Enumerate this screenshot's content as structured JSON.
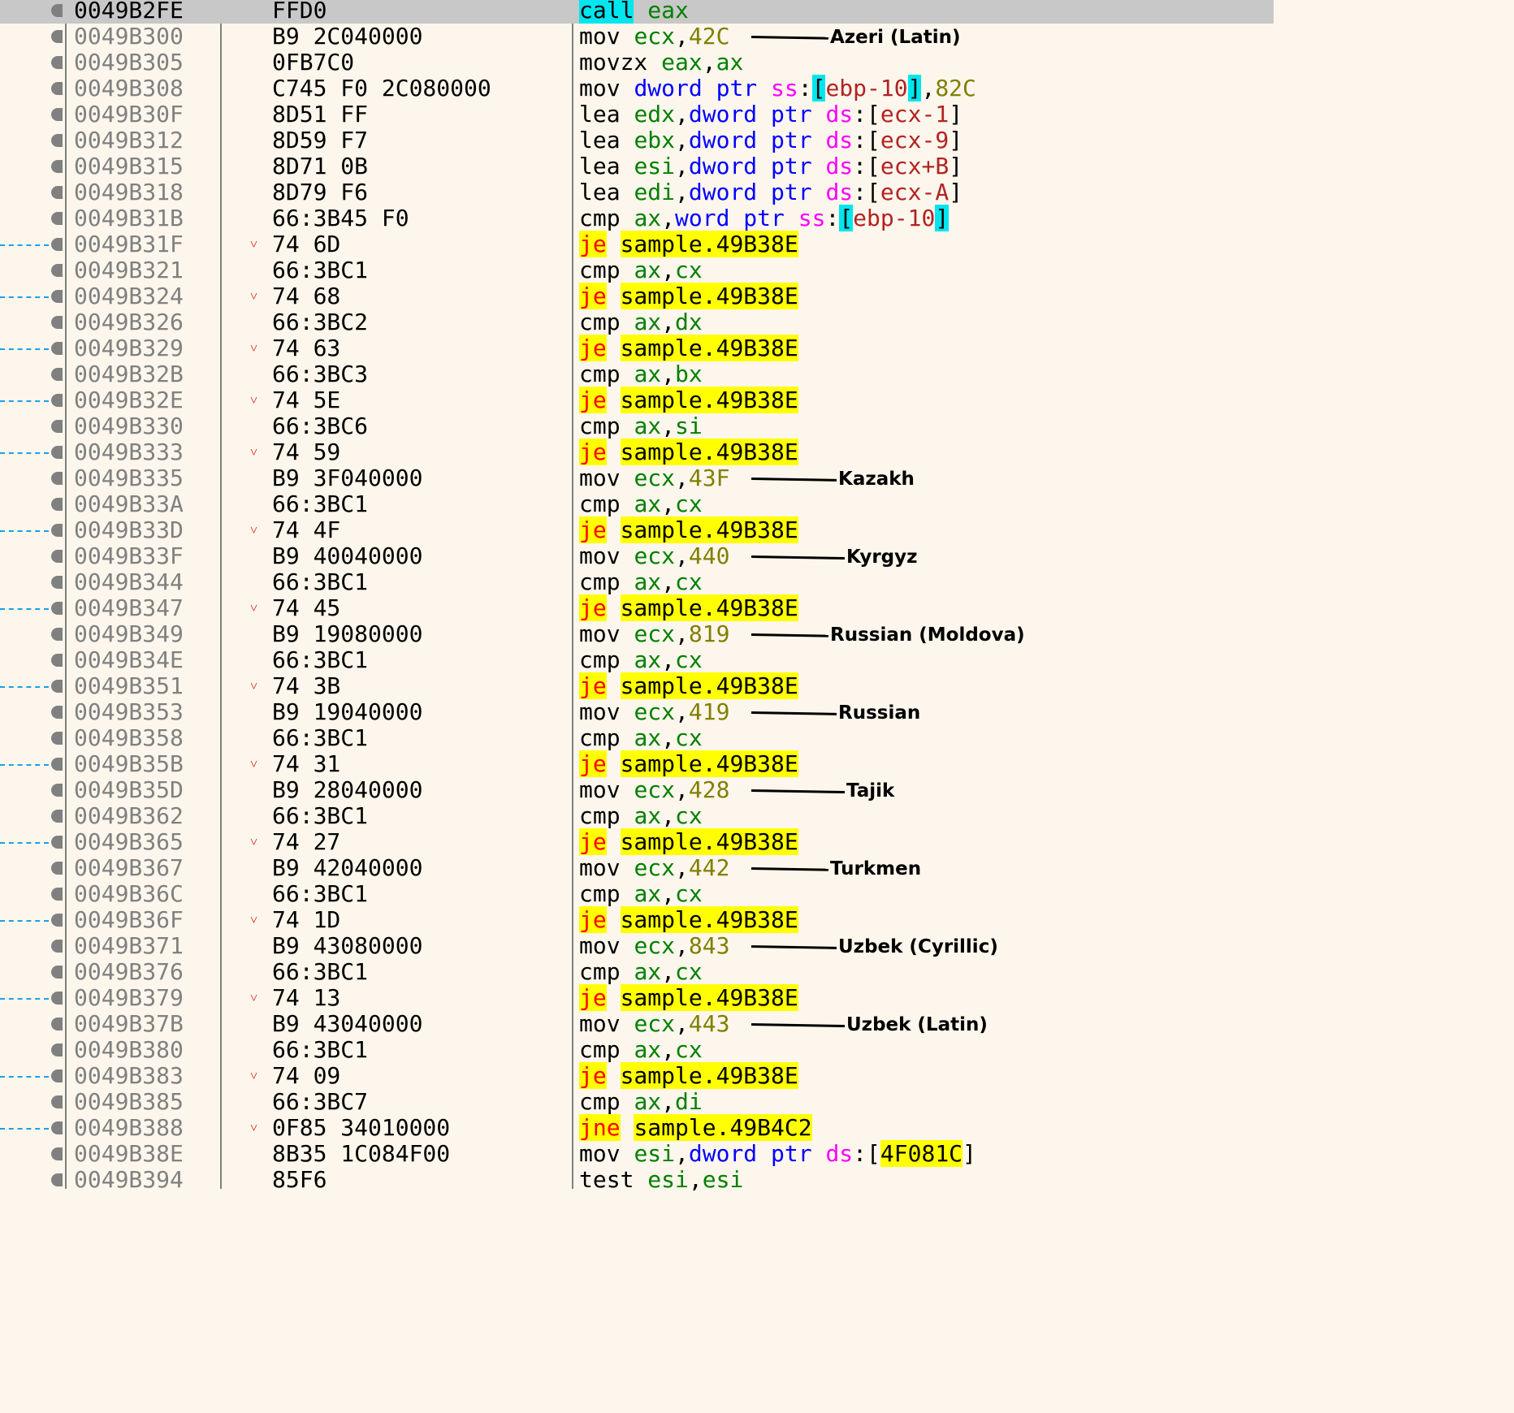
{
  "rows": [
    {
      "addr": "0049B2FE",
      "bytes": "FFD0",
      "jump": false,
      "selected": true,
      "ins": [
        [
          "callhl",
          "call"
        ],
        [
          "sp",
          " "
        ],
        [
          "reg",
          "eax"
        ]
      ]
    },
    {
      "addr": "0049B300",
      "bytes": "B9 2C040000",
      "jump": false,
      "ins": [
        [
          "mn",
          "mov"
        ],
        [
          "sp",
          " "
        ],
        [
          "reg",
          "ecx"
        ],
        [
          "p",
          ","
        ],
        [
          "num",
          "42C"
        ]
      ]
    },
    {
      "addr": "0049B305",
      "bytes": "0FB7C0",
      "jump": false,
      "ins": [
        [
          "mn",
          "movzx"
        ],
        [
          "sp",
          " "
        ],
        [
          "reg",
          "eax"
        ],
        [
          "p",
          ","
        ],
        [
          "reg",
          "ax"
        ]
      ]
    },
    {
      "addr": "0049B308",
      "bytes": "C745 F0 2C080000",
      "jump": false,
      "ins": [
        [
          "mn",
          "mov"
        ],
        [
          "sp",
          " "
        ],
        [
          "kw",
          "dword ptr"
        ],
        [
          "sp",
          " "
        ],
        [
          "seg",
          "ss"
        ],
        [
          "p",
          ":"
        ],
        [
          "brhl",
          "["
        ],
        [
          "mem",
          "ebp-10"
        ],
        [
          "brhl",
          "]"
        ],
        [
          "p",
          ","
        ],
        [
          "num",
          "82C"
        ]
      ]
    },
    {
      "addr": "0049B30F",
      "bytes": "8D51 FF",
      "jump": false,
      "ins": [
        [
          "mn",
          "lea"
        ],
        [
          "sp",
          " "
        ],
        [
          "reg",
          "edx"
        ],
        [
          "p",
          ","
        ],
        [
          "kw",
          "dword ptr"
        ],
        [
          "sp",
          " "
        ],
        [
          "seg",
          "ds"
        ],
        [
          "p",
          ":"
        ],
        [
          "br",
          "["
        ],
        [
          "mem",
          "ecx-1"
        ],
        [
          "br",
          "]"
        ]
      ]
    },
    {
      "addr": "0049B312",
      "bytes": "8D59 F7",
      "jump": false,
      "ins": [
        [
          "mn",
          "lea"
        ],
        [
          "sp",
          " "
        ],
        [
          "reg",
          "ebx"
        ],
        [
          "p",
          ","
        ],
        [
          "kw",
          "dword ptr"
        ],
        [
          "sp",
          " "
        ],
        [
          "seg",
          "ds"
        ],
        [
          "p",
          ":"
        ],
        [
          "br",
          "["
        ],
        [
          "mem",
          "ecx-9"
        ],
        [
          "br",
          "]"
        ]
      ]
    },
    {
      "addr": "0049B315",
      "bytes": "8D71 0B",
      "jump": false,
      "ins": [
        [
          "mn",
          "lea"
        ],
        [
          "sp",
          " "
        ],
        [
          "reg",
          "esi"
        ],
        [
          "p",
          ","
        ],
        [
          "kw",
          "dword ptr"
        ],
        [
          "sp",
          " "
        ],
        [
          "seg",
          "ds"
        ],
        [
          "p",
          ":"
        ],
        [
          "br",
          "["
        ],
        [
          "mem",
          "ecx+B"
        ],
        [
          "br",
          "]"
        ]
      ]
    },
    {
      "addr": "0049B318",
      "bytes": "8D79 F6",
      "jump": false,
      "ins": [
        [
          "mn",
          "lea"
        ],
        [
          "sp",
          " "
        ],
        [
          "reg",
          "edi"
        ],
        [
          "p",
          ","
        ],
        [
          "kw",
          "dword ptr"
        ],
        [
          "sp",
          " "
        ],
        [
          "seg",
          "ds"
        ],
        [
          "p",
          ":"
        ],
        [
          "br",
          "["
        ],
        [
          "mem",
          "ecx-A"
        ],
        [
          "br",
          "]"
        ]
      ]
    },
    {
      "addr": "0049B31B",
      "bytes": "66:3B45 F0",
      "jump": false,
      "ins": [
        [
          "mn",
          "cmp"
        ],
        [
          "sp",
          " "
        ],
        [
          "reg",
          "ax"
        ],
        [
          "p",
          ","
        ],
        [
          "kw",
          "word ptr"
        ],
        [
          "sp",
          " "
        ],
        [
          "seg",
          "ss"
        ],
        [
          "p",
          ":"
        ],
        [
          "brhl",
          "["
        ],
        [
          "mem",
          "ebp-10"
        ],
        [
          "brhl",
          "]"
        ]
      ]
    },
    {
      "addr": "0049B31F",
      "bytes": "74 6D",
      "jump": true,
      "ins": [
        [
          "jcc",
          "je"
        ],
        [
          "sp",
          " "
        ],
        [
          "tgt",
          "sample.49B38E"
        ]
      ]
    },
    {
      "addr": "0049B321",
      "bytes": "66:3BC1",
      "jump": false,
      "ins": [
        [
          "mn",
          "cmp"
        ],
        [
          "sp",
          " "
        ],
        [
          "reg",
          "ax"
        ],
        [
          "p",
          ","
        ],
        [
          "reg",
          "cx"
        ]
      ]
    },
    {
      "addr": "0049B324",
      "bytes": "74 68",
      "jump": true,
      "ins": [
        [
          "jcc",
          "je"
        ],
        [
          "sp",
          " "
        ],
        [
          "tgt",
          "sample.49B38E"
        ]
      ]
    },
    {
      "addr": "0049B326",
      "bytes": "66:3BC2",
      "jump": false,
      "ins": [
        [
          "mn",
          "cmp"
        ],
        [
          "sp",
          " "
        ],
        [
          "reg",
          "ax"
        ],
        [
          "p",
          ","
        ],
        [
          "reg",
          "dx"
        ]
      ]
    },
    {
      "addr": "0049B329",
      "bytes": "74 63",
      "jump": true,
      "ins": [
        [
          "jcc",
          "je"
        ],
        [
          "sp",
          " "
        ],
        [
          "tgt",
          "sample.49B38E"
        ]
      ]
    },
    {
      "addr": "0049B32B",
      "bytes": "66:3BC3",
      "jump": false,
      "ins": [
        [
          "mn",
          "cmp"
        ],
        [
          "sp",
          " "
        ],
        [
          "reg",
          "ax"
        ],
        [
          "p",
          ","
        ],
        [
          "reg",
          "bx"
        ]
      ]
    },
    {
      "addr": "0049B32E",
      "bytes": "74 5E",
      "jump": true,
      "ins": [
        [
          "jcc",
          "je"
        ],
        [
          "sp",
          " "
        ],
        [
          "tgt",
          "sample.49B38E"
        ]
      ]
    },
    {
      "addr": "0049B330",
      "bytes": "66:3BC6",
      "jump": false,
      "ins": [
        [
          "mn",
          "cmp"
        ],
        [
          "sp",
          " "
        ],
        [
          "reg",
          "ax"
        ],
        [
          "p",
          ","
        ],
        [
          "reg",
          "si"
        ]
      ]
    },
    {
      "addr": "0049B333",
      "bytes": "74 59",
      "jump": true,
      "ins": [
        [
          "jcc",
          "je"
        ],
        [
          "sp",
          " "
        ],
        [
          "tgt",
          "sample.49B38E"
        ]
      ]
    },
    {
      "addr": "0049B335",
      "bytes": "B9 3F040000",
      "jump": false,
      "ins": [
        [
          "mn",
          "mov"
        ],
        [
          "sp",
          " "
        ],
        [
          "reg",
          "ecx"
        ],
        [
          "p",
          ","
        ],
        [
          "num",
          "43F"
        ]
      ]
    },
    {
      "addr": "0049B33A",
      "bytes": "66:3BC1",
      "jump": false,
      "ins": [
        [
          "mn",
          "cmp"
        ],
        [
          "sp",
          " "
        ],
        [
          "reg",
          "ax"
        ],
        [
          "p",
          ","
        ],
        [
          "reg",
          "cx"
        ]
      ]
    },
    {
      "addr": "0049B33D",
      "bytes": "74 4F",
      "jump": true,
      "ins": [
        [
          "jcc",
          "je"
        ],
        [
          "sp",
          " "
        ],
        [
          "tgt",
          "sample.49B38E"
        ]
      ]
    },
    {
      "addr": "0049B33F",
      "bytes": "B9 40040000",
      "jump": false,
      "ins": [
        [
          "mn",
          "mov"
        ],
        [
          "sp",
          " "
        ],
        [
          "reg",
          "ecx"
        ],
        [
          "p",
          ","
        ],
        [
          "num",
          "440"
        ]
      ]
    },
    {
      "addr": "0049B344",
      "bytes": "66:3BC1",
      "jump": false,
      "ins": [
        [
          "mn",
          "cmp"
        ],
        [
          "sp",
          " "
        ],
        [
          "reg",
          "ax"
        ],
        [
          "p",
          ","
        ],
        [
          "reg",
          "cx"
        ]
      ]
    },
    {
      "addr": "0049B347",
      "bytes": "74 45",
      "jump": true,
      "ins": [
        [
          "jcc",
          "je"
        ],
        [
          "sp",
          " "
        ],
        [
          "tgt",
          "sample.49B38E"
        ]
      ]
    },
    {
      "addr": "0049B349",
      "bytes": "B9 19080000",
      "jump": false,
      "ins": [
        [
          "mn",
          "mov"
        ],
        [
          "sp",
          " "
        ],
        [
          "reg",
          "ecx"
        ],
        [
          "p",
          ","
        ],
        [
          "num",
          "819"
        ]
      ]
    },
    {
      "addr": "0049B34E",
      "bytes": "66:3BC1",
      "jump": false,
      "ins": [
        [
          "mn",
          "cmp"
        ],
        [
          "sp",
          " "
        ],
        [
          "reg",
          "ax"
        ],
        [
          "p",
          ","
        ],
        [
          "reg",
          "cx"
        ]
      ]
    },
    {
      "addr": "0049B351",
      "bytes": "74 3B",
      "jump": true,
      "ins": [
        [
          "jcc",
          "je"
        ],
        [
          "sp",
          " "
        ],
        [
          "tgt",
          "sample.49B38E"
        ]
      ]
    },
    {
      "addr": "0049B353",
      "bytes": "B9 19040000",
      "jump": false,
      "ins": [
        [
          "mn",
          "mov"
        ],
        [
          "sp",
          " "
        ],
        [
          "reg",
          "ecx"
        ],
        [
          "p",
          ","
        ],
        [
          "num",
          "419"
        ]
      ]
    },
    {
      "addr": "0049B358",
      "bytes": "66:3BC1",
      "jump": false,
      "ins": [
        [
          "mn",
          "cmp"
        ],
        [
          "sp",
          " "
        ],
        [
          "reg",
          "ax"
        ],
        [
          "p",
          ","
        ],
        [
          "reg",
          "cx"
        ]
      ]
    },
    {
      "addr": "0049B35B",
      "bytes": "74 31",
      "jump": true,
      "ins": [
        [
          "jcc",
          "je"
        ],
        [
          "sp",
          " "
        ],
        [
          "tgt",
          "sample.49B38E"
        ]
      ]
    },
    {
      "addr": "0049B35D",
      "bytes": "B9 28040000",
      "jump": false,
      "ins": [
        [
          "mn",
          "mov"
        ],
        [
          "sp",
          " "
        ],
        [
          "reg",
          "ecx"
        ],
        [
          "p",
          ","
        ],
        [
          "num",
          "428"
        ]
      ]
    },
    {
      "addr": "0049B362",
      "bytes": "66:3BC1",
      "jump": false,
      "ins": [
        [
          "mn",
          "cmp"
        ],
        [
          "sp",
          " "
        ],
        [
          "reg",
          "ax"
        ],
        [
          "p",
          ","
        ],
        [
          "reg",
          "cx"
        ]
      ]
    },
    {
      "addr": "0049B365",
      "bytes": "74 27",
      "jump": true,
      "ins": [
        [
          "jcc",
          "je"
        ],
        [
          "sp",
          " "
        ],
        [
          "tgt",
          "sample.49B38E"
        ]
      ]
    },
    {
      "addr": "0049B367",
      "bytes": "B9 42040000",
      "jump": false,
      "ins": [
        [
          "mn",
          "mov"
        ],
        [
          "sp",
          " "
        ],
        [
          "reg",
          "ecx"
        ],
        [
          "p",
          ","
        ],
        [
          "num",
          "442"
        ]
      ]
    },
    {
      "addr": "0049B36C",
      "bytes": "66:3BC1",
      "jump": false,
      "ins": [
        [
          "mn",
          "cmp"
        ],
        [
          "sp",
          " "
        ],
        [
          "reg",
          "ax"
        ],
        [
          "p",
          ","
        ],
        [
          "reg",
          "cx"
        ]
      ]
    },
    {
      "addr": "0049B36F",
      "bytes": "74 1D",
      "jump": true,
      "ins": [
        [
          "jcc",
          "je"
        ],
        [
          "sp",
          " "
        ],
        [
          "tgt",
          "sample.49B38E"
        ]
      ]
    },
    {
      "addr": "0049B371",
      "bytes": "B9 43080000",
      "jump": false,
      "ins": [
        [
          "mn",
          "mov"
        ],
        [
          "sp",
          " "
        ],
        [
          "reg",
          "ecx"
        ],
        [
          "p",
          ","
        ],
        [
          "num",
          "843"
        ]
      ]
    },
    {
      "addr": "0049B376",
      "bytes": "66:3BC1",
      "jump": false,
      "ins": [
        [
          "mn",
          "cmp"
        ],
        [
          "sp",
          " "
        ],
        [
          "reg",
          "ax"
        ],
        [
          "p",
          ","
        ],
        [
          "reg",
          "cx"
        ]
      ]
    },
    {
      "addr": "0049B379",
      "bytes": "74 13",
      "jump": true,
      "ins": [
        [
          "jcc",
          "je"
        ],
        [
          "sp",
          " "
        ],
        [
          "tgt",
          "sample.49B38E"
        ]
      ]
    },
    {
      "addr": "0049B37B",
      "bytes": "B9 43040000",
      "jump": false,
      "ins": [
        [
          "mn",
          "mov"
        ],
        [
          "sp",
          " "
        ],
        [
          "reg",
          "ecx"
        ],
        [
          "p",
          ","
        ],
        [
          "num",
          "443"
        ]
      ]
    },
    {
      "addr": "0049B380",
      "bytes": "66:3BC1",
      "jump": false,
      "ins": [
        [
          "mn",
          "cmp"
        ],
        [
          "sp",
          " "
        ],
        [
          "reg",
          "ax"
        ],
        [
          "p",
          ","
        ],
        [
          "reg",
          "cx"
        ]
      ]
    },
    {
      "addr": "0049B383",
      "bytes": "74 09",
      "jump": true,
      "ins": [
        [
          "jcc",
          "je"
        ],
        [
          "sp",
          " "
        ],
        [
          "tgt",
          "sample.49B38E"
        ]
      ]
    },
    {
      "addr": "0049B385",
      "bytes": "66:3BC7",
      "jump": false,
      "ins": [
        [
          "mn",
          "cmp"
        ],
        [
          "sp",
          " "
        ],
        [
          "reg",
          "ax"
        ],
        [
          "p",
          ","
        ],
        [
          "reg",
          "di"
        ]
      ]
    },
    {
      "addr": "0049B388",
      "bytes": "0F85 34010000",
      "jump": true,
      "ins": [
        [
          "jcc",
          "jne"
        ],
        [
          "sp",
          " "
        ],
        [
          "tgt",
          "sample.49B4C2"
        ]
      ]
    },
    {
      "addr": "0049B38E",
      "bytes": "8B35 1C084F00",
      "jump": false,
      "ins": [
        [
          "mn",
          "mov"
        ],
        [
          "sp",
          " "
        ],
        [
          "reg",
          "esi"
        ],
        [
          "p",
          ","
        ],
        [
          "kw",
          "dword ptr"
        ],
        [
          "sp",
          " "
        ],
        [
          "seg",
          "ds"
        ],
        [
          "p",
          ":"
        ],
        [
          "br",
          "["
        ],
        [
          "hlnum",
          "4F081C"
        ],
        [
          "br",
          "]"
        ]
      ]
    },
    {
      "addr": "0049B394",
      "bytes": "85F6",
      "jump": false,
      "ins": [
        [
          "mn",
          "test"
        ],
        [
          "sp",
          " "
        ],
        [
          "reg",
          "esi"
        ],
        [
          "p",
          ","
        ],
        [
          "reg",
          "esi"
        ]
      ]
    }
  ],
  "annotations": [
    {
      "row": 1,
      "label": "Azeri (Latin)"
    },
    {
      "row": 18,
      "label": "Kazakh"
    },
    {
      "row": 21,
      "label": "Kyrgyz"
    },
    {
      "row": 24,
      "label": "Russian (Moldova)"
    },
    {
      "row": 27,
      "label": "Russian"
    },
    {
      "row": 30,
      "label": "Tajik"
    },
    {
      "row": 33,
      "label": "Turkmen"
    },
    {
      "row": 36,
      "label": "Uzbek (Cyrillic)"
    },
    {
      "row": 39,
      "label": "Uzbek (Latin)"
    }
  ],
  "jump_arrow_glyph": "˅",
  "colors": {
    "background": "#fdf6ec",
    "register": "#008000",
    "number": "#808000",
    "segment": "#ff00ff",
    "keyword": "#0000ff",
    "memory": "#b22222",
    "jump_mnemonic": "#ff0000",
    "highlight_yellow": "#ffff00",
    "highlight_cyan": "#00e5ee",
    "jump_line": "#1ca0e6"
  }
}
